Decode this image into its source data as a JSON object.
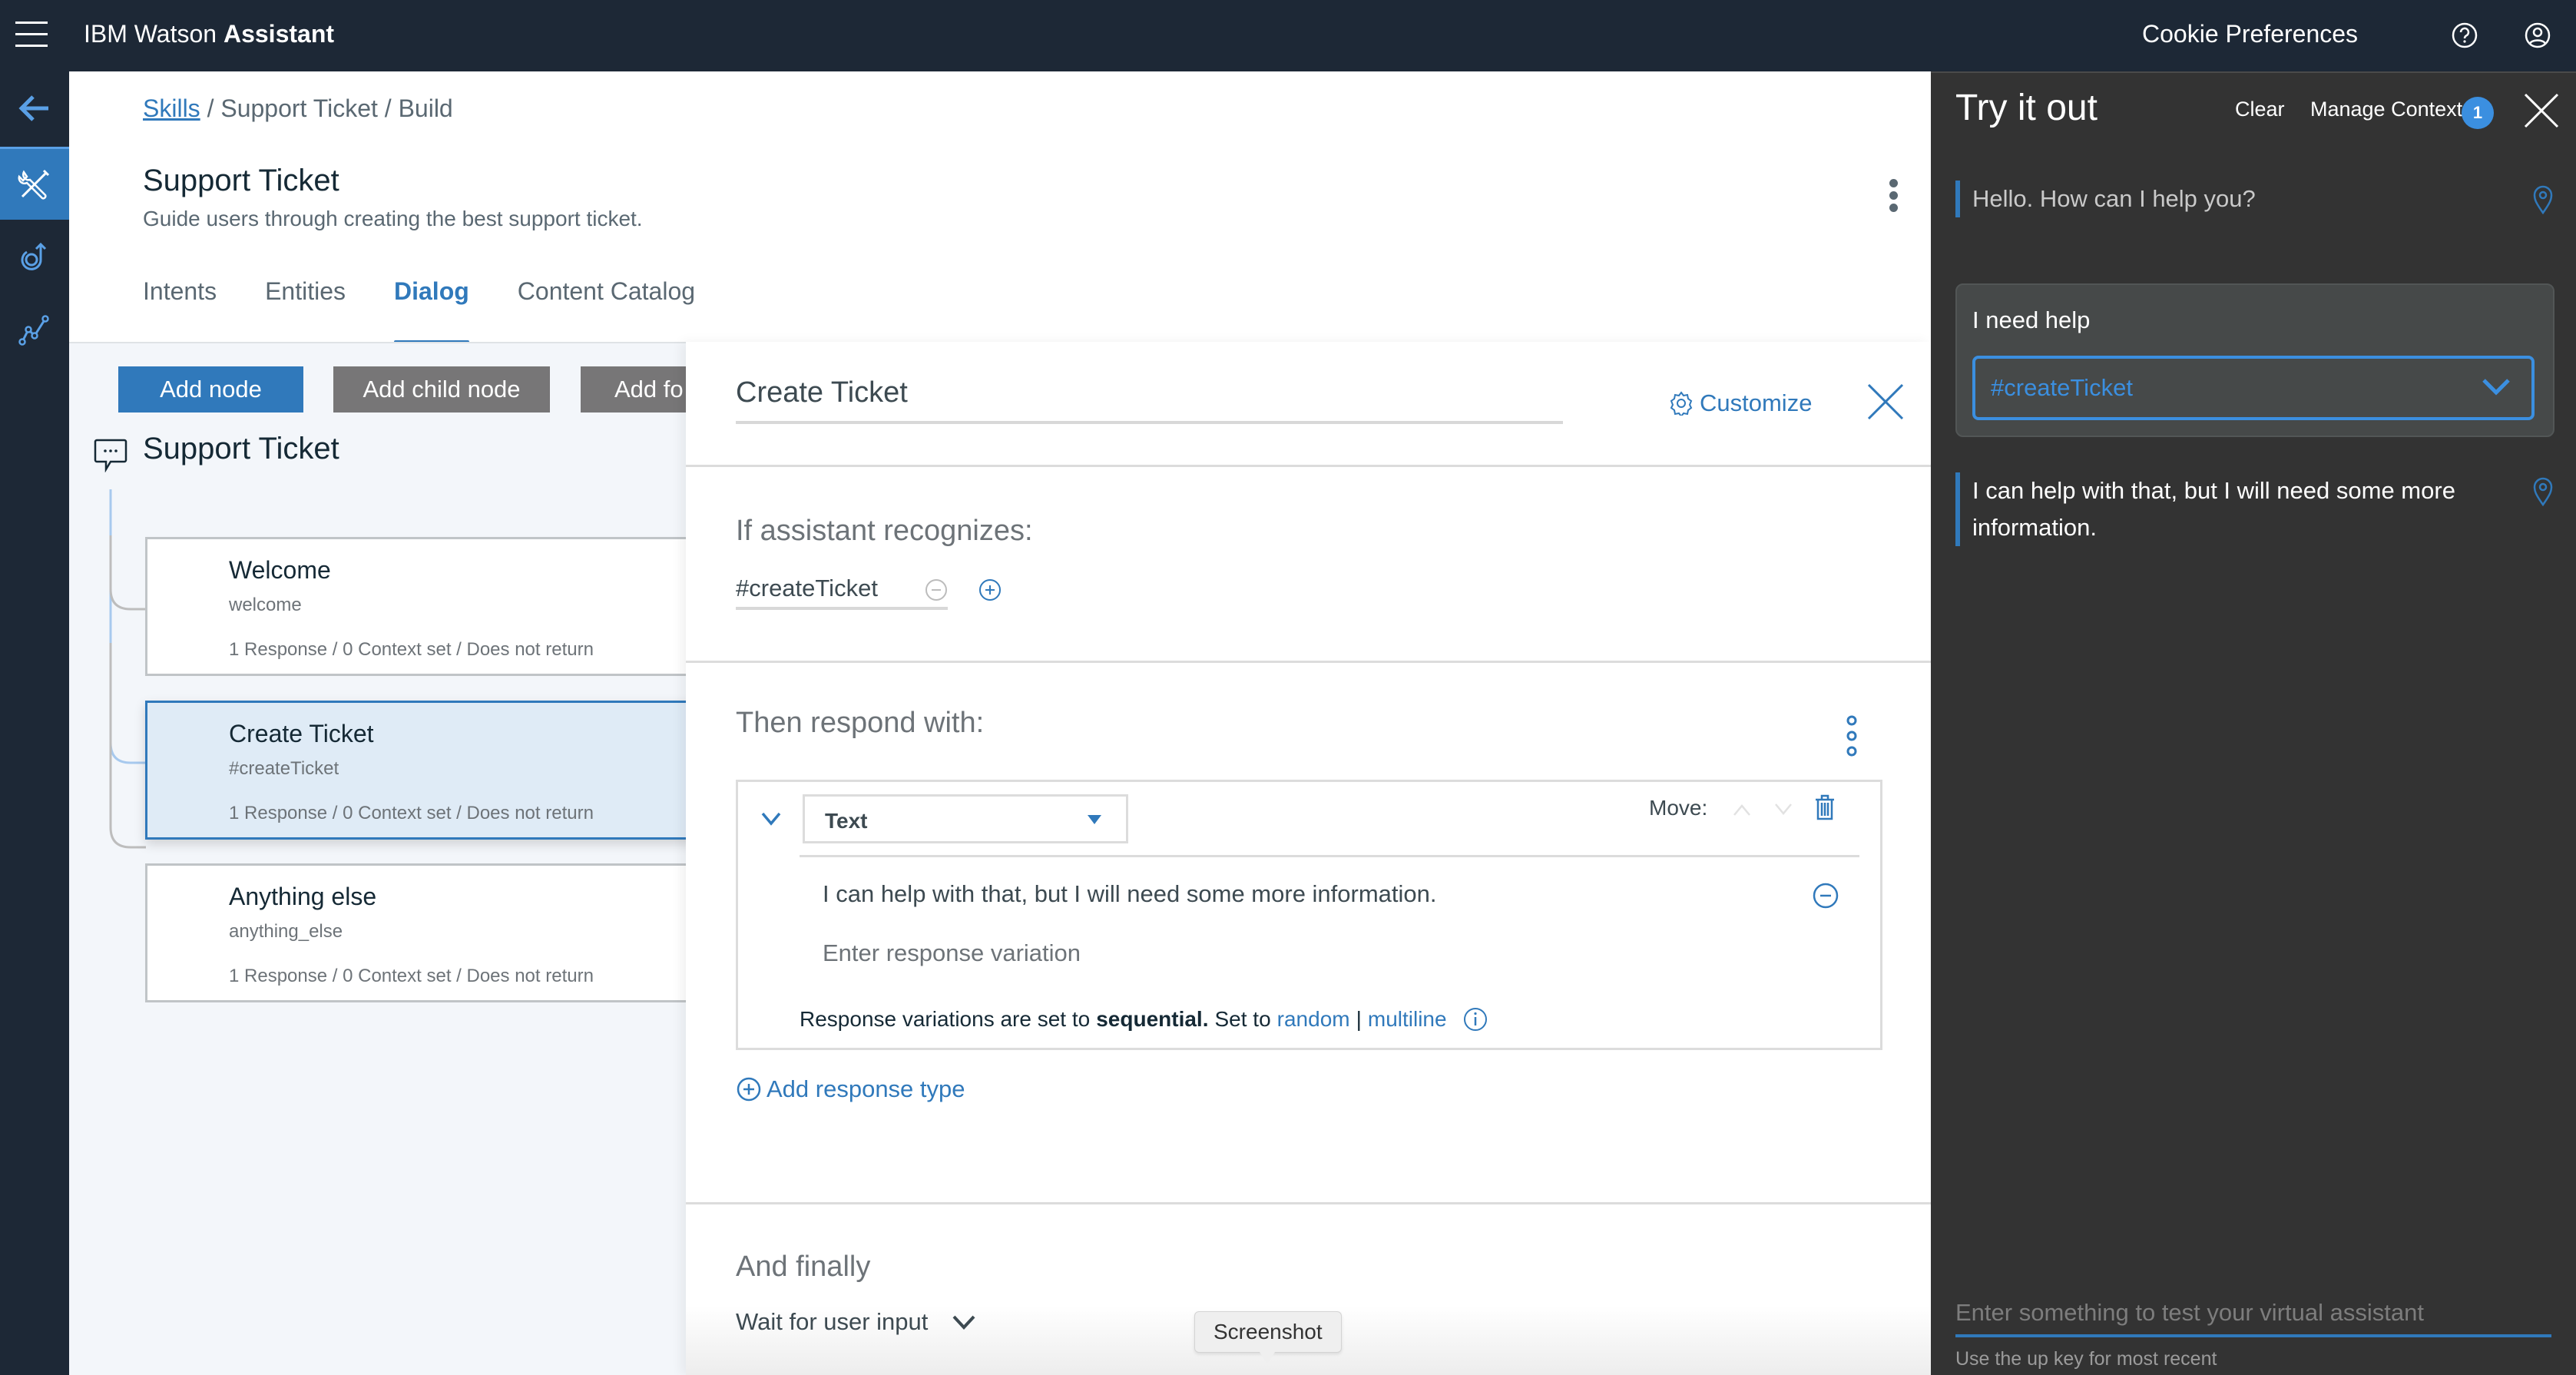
{
  "topbar": {
    "brand_regular": "IBM Watson",
    "brand_bold": "Assistant",
    "cookie_label": "Cookie Preferences",
    "icons": [
      "hamburger-menu-icon",
      "help-icon",
      "user-account-icon"
    ]
  },
  "rail": {
    "items": [
      {
        "name": "back",
        "icon": "arrow-left-icon",
        "active": false
      },
      {
        "name": "build",
        "icon": "wrench-screwdriver-icon",
        "active": true
      },
      {
        "name": "improve",
        "icon": "loop-arrow-icon",
        "active": false
      },
      {
        "name": "analytics",
        "icon": "line-graph-icon",
        "active": false
      }
    ]
  },
  "header": {
    "breadcrumb": {
      "root": "Skills",
      "rest": "/ Support Ticket / Build"
    },
    "title": "Support Ticket",
    "description": "Guide users through creating the best support ticket.",
    "tabs": [
      {
        "label": "Intents",
        "active": false
      },
      {
        "label": "Entities",
        "active": false
      },
      {
        "label": "Dialog",
        "active": true
      },
      {
        "label": "Content Catalog",
        "active": false
      }
    ]
  },
  "dialog_tree": {
    "buttons": {
      "add_node": "Add node",
      "add_child_node": "Add child node",
      "add_folder": "Add fo"
    },
    "root_title": "Support Ticket",
    "nodes": [
      {
        "title": "Welcome",
        "condition": "welcome",
        "meta": "1 Response / 0 Context set / Does not return",
        "selected": false
      },
      {
        "title": "Create Ticket",
        "condition": "#createTicket",
        "meta": "1 Response / 0 Context set / Does not return",
        "selected": true
      },
      {
        "title": "Anything else",
        "condition": "anything_else",
        "meta": "1 Response / 0 Context set / Does not return",
        "selected": false
      }
    ]
  },
  "editor": {
    "node_name": "Create Ticket",
    "customize_label": "Customize",
    "condition_label": "If assistant recognizes:",
    "condition_value": "#createTicket",
    "respond_label": "Then respond with:",
    "response": {
      "type": "Text",
      "move_label": "Move:",
      "text": "I can help with that, but I will need some more information.",
      "variation_placeholder": "Enter response variation",
      "note_prefix": "Response variations are set to",
      "note_mode": "sequential.",
      "note_set_to": "Set to",
      "note_random": "random",
      "note_sep": "|",
      "note_multiline": "multiline"
    },
    "add_response_label": "Add response type",
    "finally_label": "And finally",
    "finally_action": "Wait for user input",
    "tooltip": "Screenshot"
  },
  "try_panel": {
    "title": "Try it out",
    "clear_label": "Clear",
    "manage_context_label": "Manage Context",
    "context_count": "1",
    "messages": [
      {
        "from": "bot",
        "text": "Hello. How can I help you?"
      },
      {
        "from": "user",
        "text": "I need help",
        "intent": "#createTicket"
      },
      {
        "from": "bot",
        "text": "I can help with that, but I will need some more information."
      }
    ],
    "input_placeholder": "Enter something to test your virtual assistant",
    "input_hint": "Use the up key for most recent"
  }
}
